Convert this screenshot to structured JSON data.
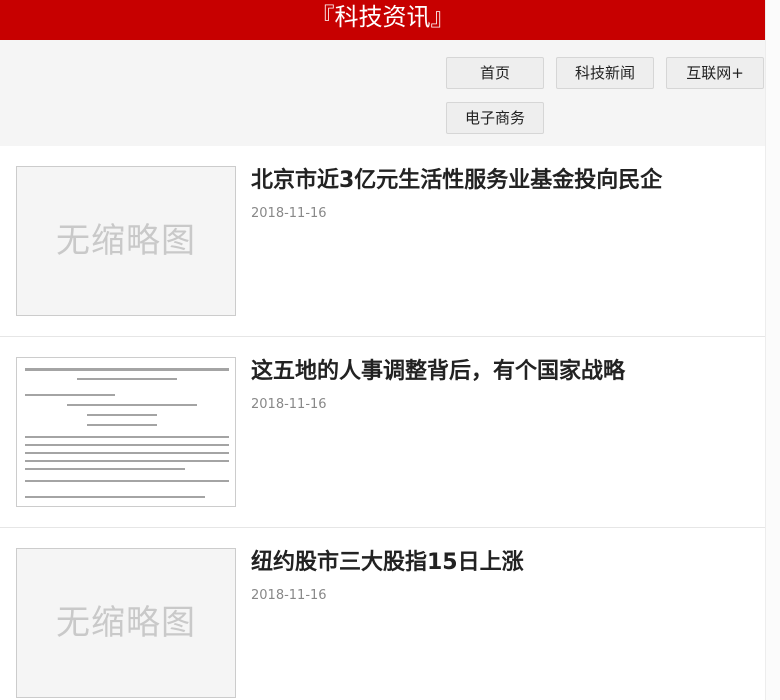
{
  "header": {
    "title": "『科技资讯』"
  },
  "nav": {
    "items": [
      {
        "label": "首页"
      },
      {
        "label": "科技新闻"
      },
      {
        "label": "互联网+"
      },
      {
        "label": "电子商务"
      }
    ]
  },
  "articles": [
    {
      "title": "北京市近3亿元生活性服务业基金投向民企",
      "date": "2018-11-16",
      "thumbnail_text": "无缩略图"
    },
    {
      "title": "这五地的人事调整背后，有个国家战略",
      "date": "2018-11-16",
      "thumbnail_text": ""
    },
    {
      "title": "纽约股市三大股指15日上涨",
      "date": "2018-11-16",
      "thumbnail_text": "无缩略图"
    }
  ],
  "colors": {
    "header_bg": "#c70000",
    "nav_bg": "#f5f5f5",
    "date_text": "#888888"
  }
}
